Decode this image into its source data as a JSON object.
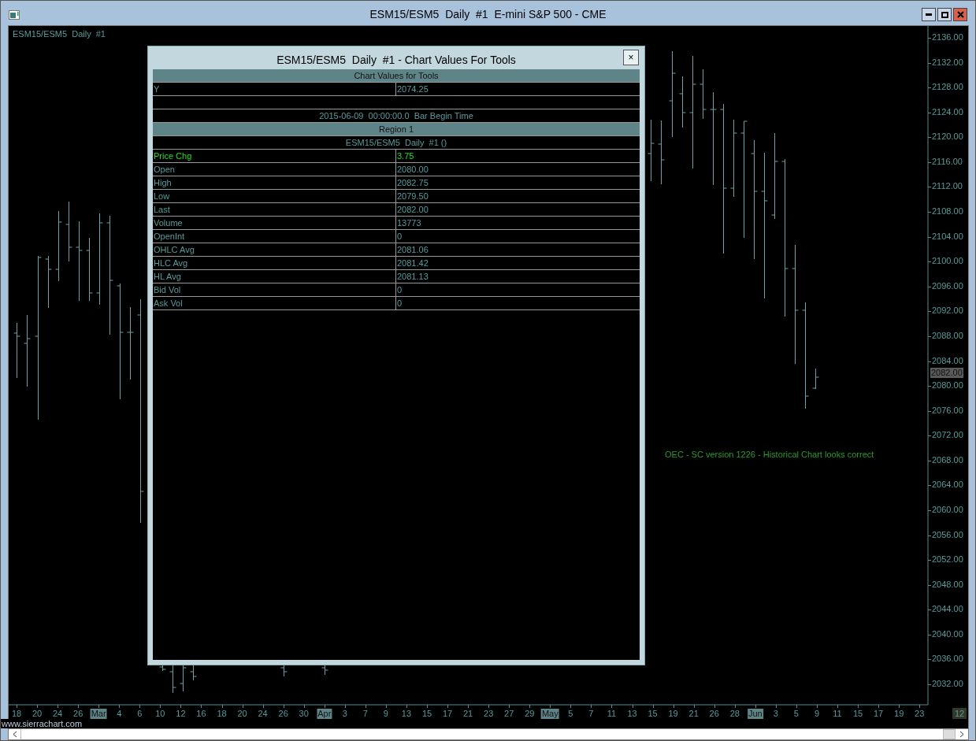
{
  "window": {
    "title": "ESM15/ESM5  Daily  #1  E-mini S&P 500 - CME"
  },
  "chart": {
    "label": "ESM15/ESM5  Daily  #1",
    "y_axis_labels": [
      "2136.00",
      "2132.00",
      "2128.00",
      "2124.00",
      "2120.00",
      "2116.00",
      "2112.00",
      "2108.00",
      "2104.00",
      "2100.00",
      "2096.00",
      "2092.00",
      "2088.00",
      "2084.00",
      "2080.00",
      "2076.00",
      "2072.00",
      "2068.00",
      "2064.00",
      "2060.00",
      "2056.00",
      "2052.00",
      "2048.00",
      "2044.00",
      "2040.00",
      "2036.00",
      "2032.00"
    ],
    "last_price_marker": "2082.00",
    "x_axis_labels": [
      {
        "text": "18",
        "month": false
      },
      {
        "text": "20",
        "month": false
      },
      {
        "text": "24",
        "month": false
      },
      {
        "text": "26",
        "month": false
      },
      {
        "text": "Mar",
        "month": true
      },
      {
        "text": "4",
        "month": false
      },
      {
        "text": "6",
        "month": false
      },
      {
        "text": "10",
        "month": false
      },
      {
        "text": "12",
        "month": false
      },
      {
        "text": "16",
        "month": false
      },
      {
        "text": "18",
        "month": false
      },
      {
        "text": "20",
        "month": false
      },
      {
        "text": "24",
        "month": false
      },
      {
        "text": "26",
        "month": false
      },
      {
        "text": "30",
        "month": false
      },
      {
        "text": "Apr",
        "month": true
      },
      {
        "text": "3",
        "month": false
      },
      {
        "text": "7",
        "month": false
      },
      {
        "text": "9",
        "month": false
      },
      {
        "text": "13",
        "month": false
      },
      {
        "text": "15",
        "month": false
      },
      {
        "text": "17",
        "month": false
      },
      {
        "text": "21",
        "month": false
      },
      {
        "text": "23",
        "month": false
      },
      {
        "text": "27",
        "month": false
      },
      {
        "text": "29",
        "month": false
      },
      {
        "text": "May",
        "month": true
      },
      {
        "text": "5",
        "month": false
      },
      {
        "text": "7",
        "month": false
      },
      {
        "text": "11",
        "month": false
      },
      {
        "text": "13",
        "month": false
      },
      {
        "text": "15",
        "month": false
      },
      {
        "text": "19",
        "month": false
      },
      {
        "text": "21",
        "month": false
      },
      {
        "text": "26",
        "month": false
      },
      {
        "text": "28",
        "month": false
      },
      {
        "text": "Jun",
        "month": true
      },
      {
        "text": "3",
        "month": false
      },
      {
        "text": "5",
        "month": false
      },
      {
        "text": "9",
        "month": false
      },
      {
        "text": "11",
        "month": false
      },
      {
        "text": "15",
        "month": false
      },
      {
        "text": "17",
        "month": false
      },
      {
        "text": "19",
        "month": false
      },
      {
        "text": "23",
        "month": false
      }
    ],
    "note": "OEC - SC version 1226 - Historical Chart looks correct",
    "corner_count": "12",
    "site_label": "www.sierrachart.com"
  },
  "dialog": {
    "title": "ESM15/ESM5  Daily  #1 - Chart Values For Tools",
    "close": "×",
    "rows": [
      {
        "kind": "header",
        "text": "Chart Values for Tools"
      },
      {
        "kind": "pair",
        "label": "Y",
        "value": "2074.25",
        "emphasized": false
      },
      {
        "kind": "blank"
      },
      {
        "kind": "full",
        "text": "2015-06-09  00:00:00.0  Bar Begin Time"
      },
      {
        "kind": "header",
        "text": "Region 1"
      },
      {
        "kind": "full",
        "text": "ESM15/ESM5  Daily  #1 ()"
      },
      {
        "kind": "pair",
        "label": "Price Chg",
        "value": "3.75",
        "emphasized": true
      },
      {
        "kind": "pair",
        "label": "Open",
        "value": "2080.00",
        "emphasized": false
      },
      {
        "kind": "pair",
        "label": "High",
        "value": "2082.75",
        "emphasized": false
      },
      {
        "kind": "pair",
        "label": "Low",
        "value": "2079.50",
        "emphasized": false
      },
      {
        "kind": "pair",
        "label": "Last",
        "value": "2082.00",
        "emphasized": false
      },
      {
        "kind": "pair",
        "label": "Volume",
        "value": "13773",
        "emphasized": false
      },
      {
        "kind": "pair",
        "label": "OpenInt",
        "value": "0",
        "emphasized": false
      },
      {
        "kind": "pair",
        "label": "OHLC Avg",
        "value": "2081.06",
        "emphasized": false
      },
      {
        "kind": "pair",
        "label": "HLC Avg",
        "value": "2081.42",
        "emphasized": false
      },
      {
        "kind": "pair",
        "label": "HL Avg",
        "value": "2081.13",
        "emphasized": false
      },
      {
        "kind": "pair",
        "label": "Bid Vol",
        "value": "0",
        "emphasized": false
      },
      {
        "kind": "pair",
        "label": "Ask Vol",
        "value": "0",
        "emphasized": false
      }
    ]
  }
}
